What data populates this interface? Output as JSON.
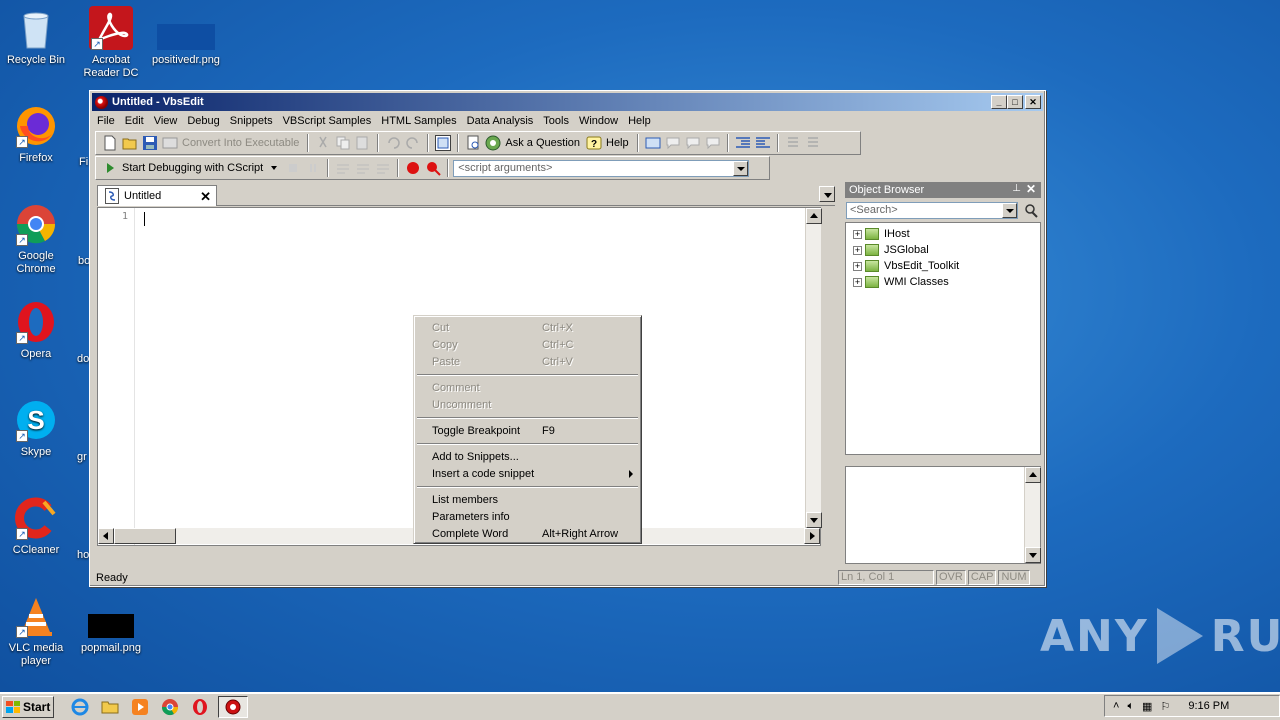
{
  "desktop": {
    "icons": [
      {
        "label": "Recycle Bin"
      },
      {
        "label": "Acrobat Reader DC"
      },
      {
        "label": "positivedr.png"
      },
      {
        "label": "Firefox"
      },
      {
        "label": "Google Chrome"
      },
      {
        "label": "Opera"
      },
      {
        "label": "Skype"
      },
      {
        "label": "CCleaner"
      },
      {
        "label": "VLC media player"
      },
      {
        "label": "popmail.png"
      }
    ],
    "truncated": [
      "Fi",
      "bo",
      "do",
      "gr",
      "ho"
    ]
  },
  "window": {
    "title": "Untitled - VbsEdit",
    "menu": [
      "File",
      "Edit",
      "View",
      "Debug",
      "Snippets",
      "VBScript Samples",
      "HTML Samples",
      "Data Analysis",
      "Tools",
      "Window",
      "Help"
    ],
    "toolbar1": {
      "convert_label": "Convert Into Executable",
      "ask_label": "Ask a Question",
      "help_label": "Help"
    },
    "toolbar2": {
      "debug_label": "Start Debugging with CScript",
      "args_placeholder": "<script arguments>"
    },
    "tab": {
      "label": "Untitled",
      "close": "✕"
    },
    "editor": {
      "line_number": "1"
    },
    "object_browser": {
      "title": "Object Browser",
      "pin": "⊥",
      "close": "✕",
      "search_placeholder": "<Search>",
      "nodes": [
        "IHost",
        "JSGlobal",
        "VbsEdit_Toolkit",
        "WMI Classes"
      ]
    },
    "context_menu": {
      "items": [
        {
          "label": "Cut",
          "shortcut": "Ctrl+X"
        },
        {
          "label": "Copy",
          "shortcut": "Ctrl+C"
        },
        {
          "label": "Paste",
          "shortcut": "Ctrl+V"
        },
        {
          "label": "Comment",
          "shortcut": ""
        },
        {
          "label": "Uncomment",
          "shortcut": ""
        },
        {
          "label": "Toggle Breakpoint",
          "shortcut": "F9"
        },
        {
          "label": "Add to Snippets...",
          "shortcut": ""
        },
        {
          "label": "Insert a code snippet",
          "shortcut": ""
        },
        {
          "label": "List members",
          "shortcut": ""
        },
        {
          "label": "Parameters info",
          "shortcut": ""
        },
        {
          "label": "Complete Word",
          "shortcut": "Alt+Right Arrow"
        }
      ]
    },
    "status": {
      "text": "Ready",
      "position": "Ln 1, Col 1",
      "ovr": "OVR",
      "cap": "CAP",
      "num": "NUM"
    }
  },
  "taskbar": {
    "start_label": "Start",
    "clock": "9:16 PM"
  },
  "watermark": {
    "left": "ANY",
    "right": "RUN"
  }
}
